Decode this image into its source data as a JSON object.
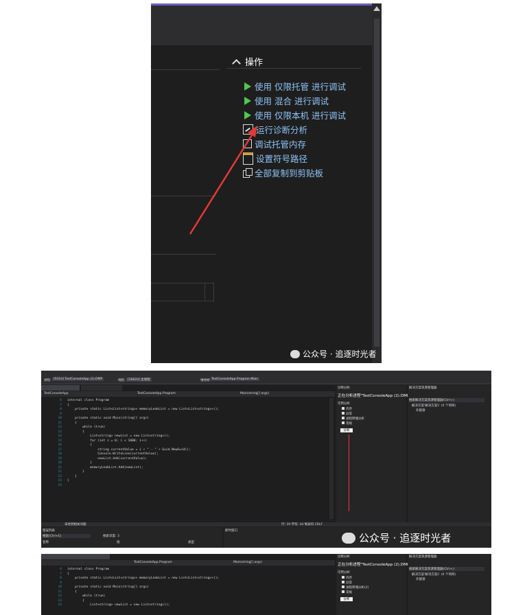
{
  "panel1": {
    "section_title": "操作",
    "actions": [
      {
        "icon": "play-icon",
        "label": "使用 仅限托管 进行调试"
      },
      {
        "icon": "play-icon",
        "label": "使用 混合 进行调试"
      },
      {
        "icon": "play-icon",
        "label": "使用 仅限本机 进行调试"
      },
      {
        "icon": "diagnostics-icon",
        "label": "运行诊断分析"
      },
      {
        "icon": "memory-icon",
        "label": "调试托管内存"
      },
      {
        "icon": "symbol-icon",
        "label": "设置符号路径"
      },
      {
        "icon": "copy-icon",
        "label": "全部复制到剪贴板"
      }
    ],
    "watermark": "公众号 · 追逐时光者",
    "arrow_color": "#e53935"
  },
  "panel2": {
    "toolbar_process_label": "进程:",
    "toolbar_process_value": "[9324] TestConsoleApp (2).DMP",
    "toolbar_thread_label": "线程:",
    "toolbar_thread_value": "[16624] 主线程",
    "toolbar_stack_label": "堆栈帧:",
    "toolbar_stack_value": "TestConsoleApp.Program.Main",
    "left_tab": "Program.cs",
    "left_tab2": "TestConsoleApp (2).DMP",
    "file_project": "TestConsoleApp",
    "file_class": "TestConsoleApp.Program",
    "file_method": "Main(string[] args)",
    "code_lines": [
      {
        "n": "6",
        "t": "internal class Program"
      },
      {
        "n": "7",
        "t": "{"
      },
      {
        "n": "8",
        "t": "    private static List<List<string>> memoryLeakList = new List<List<string>>();"
      },
      {
        "n": "9",
        "t": ""
      },
      {
        "n": "10",
        "t": "    private static void Main(string[] args)"
      },
      {
        "n": "11",
        "t": "    {"
      },
      {
        "n": "12",
        "t": "        while (true)"
      },
      {
        "n": "13",
        "t": "        {"
      },
      {
        "n": "14",
        "t": "            List<string> newList = new List<string>();"
      },
      {
        "n": "15",
        "t": "            for (int i = 0; i < 1000; i++)"
      },
      {
        "n": "16",
        "t": "            {"
      },
      {
        "n": "17",
        "t": "                string currentValue = i + \" - \" + Guid.NewGuid();"
      },
      {
        "n": "18",
        "t": "                Console.WriteLine(currentValue);"
      },
      {
        "n": "19",
        "t": "                newList.Add(currentValue);"
      },
      {
        "n": "20",
        "t": "            }"
      },
      {
        "n": "21",
        "t": "            memoryLeakList.Add(newList);"
      },
      {
        "n": "22",
        "t": "        }"
      },
      {
        "n": "23",
        "t": "    }"
      },
      {
        "n": "24",
        "t": "}"
      },
      {
        "n": "25",
        "t": ""
      }
    ],
    "diag_title": "诊断分析",
    "diag_heading": "正在分析进程\"TestConsoleApp (2).DMP\"",
    "diag_subheading": "可用分析",
    "diag_items": [
      "内存",
      "异常",
      "进程转储分析",
      "常规"
    ],
    "analyze_button": "分析",
    "solution_title": "解决方案资源管理器",
    "solution_search": "搜索解决方案资源管理器(Ctrl+;)",
    "solution_root": "解决方案'解决方案1' (0 个项目)",
    "solution_child": "外部源",
    "bottom_left_title": "错误列表",
    "bottom_search": "搜索(Ctrl+E)",
    "bottom_search_depth": "搜索深度: 3",
    "bottom_cols": [
      "名称",
      "值",
      "类型"
    ],
    "bottom_right_title": "即时窗口",
    "status_issue": "未找到相关问题",
    "status_pos": "行: 19  字符: 34  制表符  CRLF",
    "watermark": "公众号 · 追逐时光者"
  },
  "panel3": {
    "left_tab": "TestConsoleApp (2).DMP",
    "file_class": "TestConsoleApp.Program",
    "file_method": "Main(string[] args)",
    "code_lines": [
      {
        "n": "6",
        "t": "internal class Program"
      },
      {
        "n": "7",
        "t": "{"
      },
      {
        "n": "8",
        "t": "    private static List<List<string>> memoryLeakList = new List<List<string>>();"
      },
      {
        "n": "9",
        "t": ""
      },
      {
        "n": "10",
        "t": "    private static void Main(string[] args)"
      },
      {
        "n": "11",
        "t": "    {"
      },
      {
        "n": "12",
        "t": "        while (true)"
      },
      {
        "n": "13",
        "t": "        {"
      },
      {
        "n": "14",
        "t": "            List<string> newList = new List<string>();"
      }
    ],
    "diag_title": "诊断分析",
    "diag_heading": "正在分析进程\"TestConsoleApp (2).DMP\"",
    "diag_subheading": "可用分析",
    "diag_items": [
      "内存",
      "异常",
      "进程转储分析(2)",
      "常规"
    ],
    "analyze_button": "分析",
    "solution_title": "解决方案资源管理器",
    "solution_search": "搜索解决方案资源管理器(Ctrl+;)",
    "solution_root": "解决方案'解决方案1' (0 个项目)",
    "solution_child": "外部源"
  }
}
